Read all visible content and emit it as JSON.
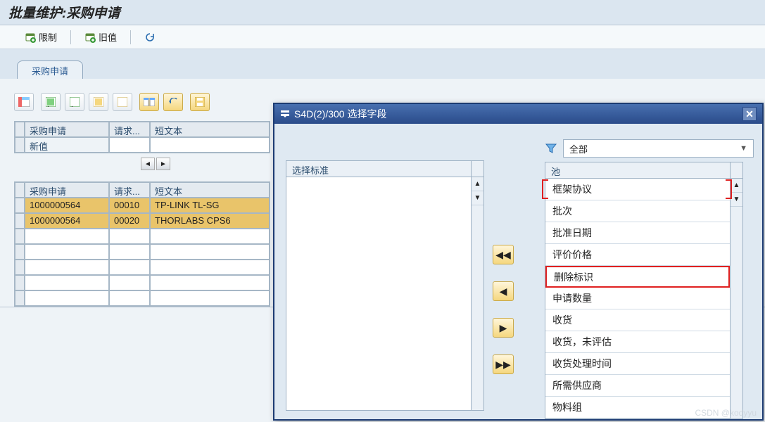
{
  "header": {
    "title": "批量维护:采购申请"
  },
  "toolbar": {
    "restrict_label": "限制",
    "old_value_label": "旧值"
  },
  "tabs": {
    "t1": "采购申请"
  },
  "grid1": {
    "cols": {
      "c1": "采购申请",
      "c2": "请求...",
      "c3": "短文本"
    },
    "new_value_label": "新值"
  },
  "grid2": {
    "cols": {
      "c1": "采购申请",
      "c2": "请求...",
      "c3": "短文本"
    },
    "rows": [
      {
        "c1": "1000000564",
        "c2": "00010",
        "c3": "TP-LINK TL-SG"
      },
      {
        "c1": "1000000564",
        "c2": "00020",
        "c3": "THORLABS CPS6"
      }
    ]
  },
  "dialog": {
    "title": "S4D(2)/300 选择字段",
    "left_header": "选择标准",
    "filter_value": "全部",
    "right_header": "池",
    "items": [
      "框架协议",
      "批次",
      "批准日期",
      "评价价格",
      "删除标识",
      "申请数量",
      "收货",
      "收货，未评估",
      "收货处理时间",
      "所需供应商",
      "物料组"
    ],
    "highlight_index": 4,
    "bracket_index": 0
  },
  "watermark": "CSDN @kodyyu"
}
